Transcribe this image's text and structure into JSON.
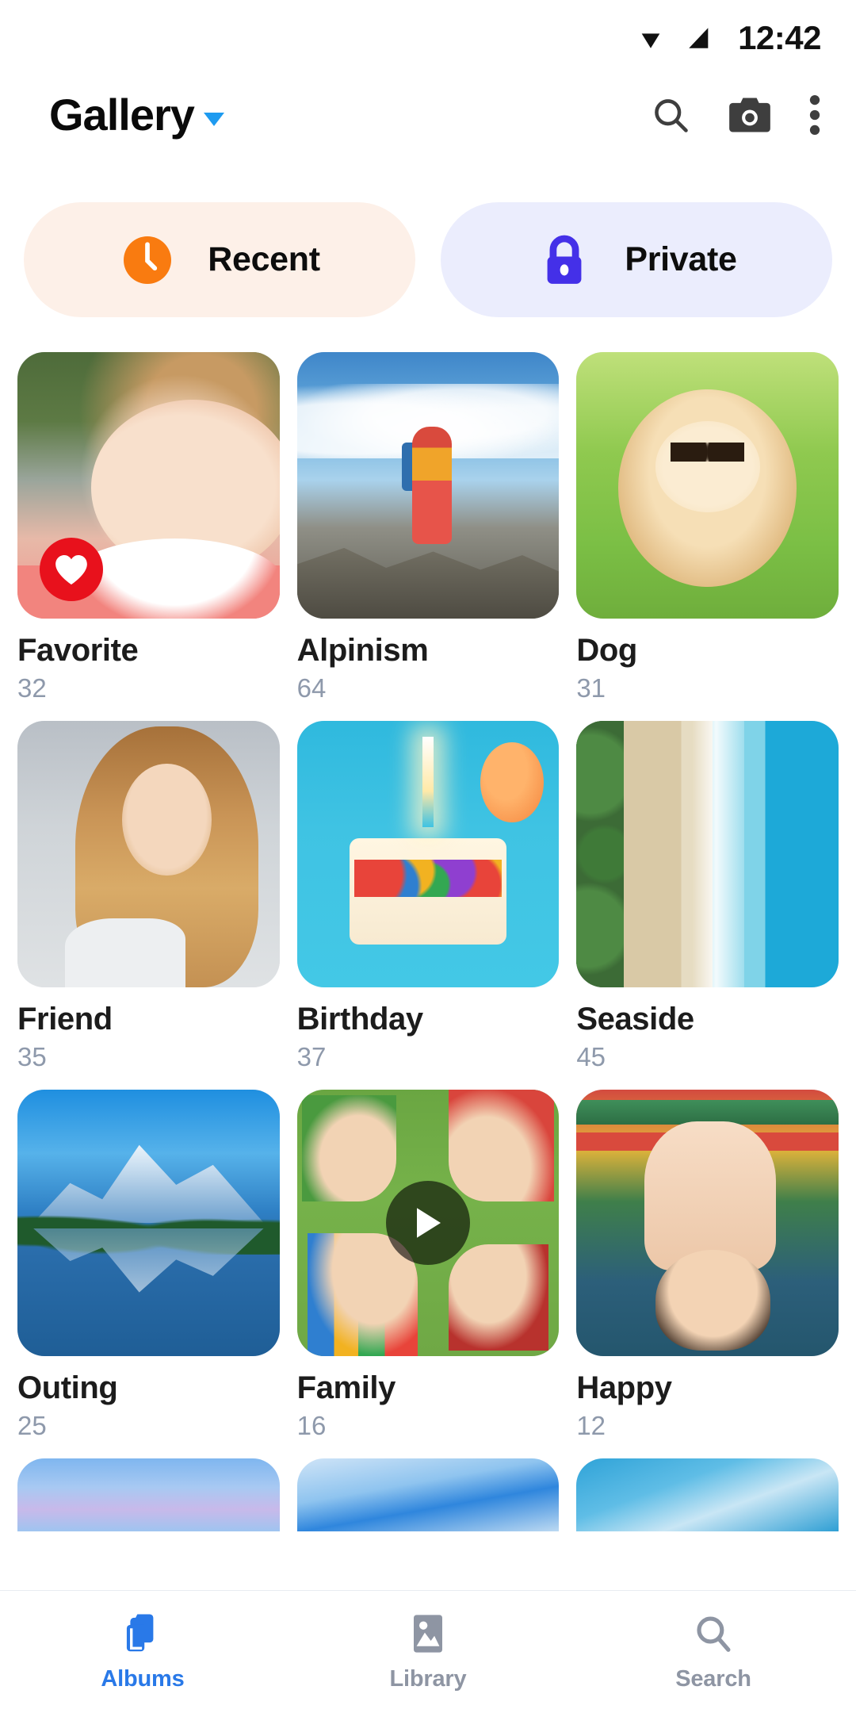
{
  "status_bar": {
    "time": "12:42",
    "icons": [
      "wifi-icon",
      "cellular-signal-icon"
    ]
  },
  "header": {
    "title": "Gallery",
    "dropdown_icon": "chevron-down-icon",
    "actions": [
      {
        "name": "search-icon",
        "label": "Search"
      },
      {
        "name": "camera-icon",
        "label": "Camera"
      },
      {
        "name": "overflow-menu-icon",
        "label": "More options"
      }
    ]
  },
  "chips": [
    {
      "label": "Recent",
      "icon": "clock-icon",
      "bg": "#FDF0E8",
      "icon_color": "#F97B10"
    },
    {
      "label": "Private",
      "icon": "lock-icon",
      "bg": "#EBEDFD",
      "icon_color": "#4430E8"
    }
  ],
  "albums": [
    {
      "name": "Favorite",
      "count": "32",
      "badge": "heart-badge",
      "art": "img-baby"
    },
    {
      "name": "Alpinism",
      "count": "64",
      "badge": null,
      "art": "img-alpin"
    },
    {
      "name": "Dog",
      "count": "31",
      "badge": null,
      "art": "img-dog"
    },
    {
      "name": "Friend",
      "count": "35",
      "badge": null,
      "art": "img-friend"
    },
    {
      "name": "Birthday",
      "count": "37",
      "badge": null,
      "art": "img-bday"
    },
    {
      "name": "Seaside",
      "count": "45",
      "badge": null,
      "art": "img-sea"
    },
    {
      "name": "Outing",
      "count": "25",
      "badge": null,
      "art": "img-outing"
    },
    {
      "name": "Family",
      "count": "16",
      "badge": "play-badge",
      "art": "img-family"
    },
    {
      "name": "Happy",
      "count": "12",
      "badge": null,
      "art": "img-happy"
    }
  ],
  "partial_row": [
    "sky1",
    "sky2",
    "sky3"
  ],
  "bottom_nav": {
    "active_color": "#2979E8",
    "inactive_color": "#8E95A3",
    "items": [
      {
        "label": "Albums",
        "icon": "albums-folder-icon",
        "active": true
      },
      {
        "label": "Library",
        "icon": "image-library-icon",
        "active": false
      },
      {
        "label": "Search",
        "icon": "search-icon",
        "active": false
      }
    ]
  }
}
